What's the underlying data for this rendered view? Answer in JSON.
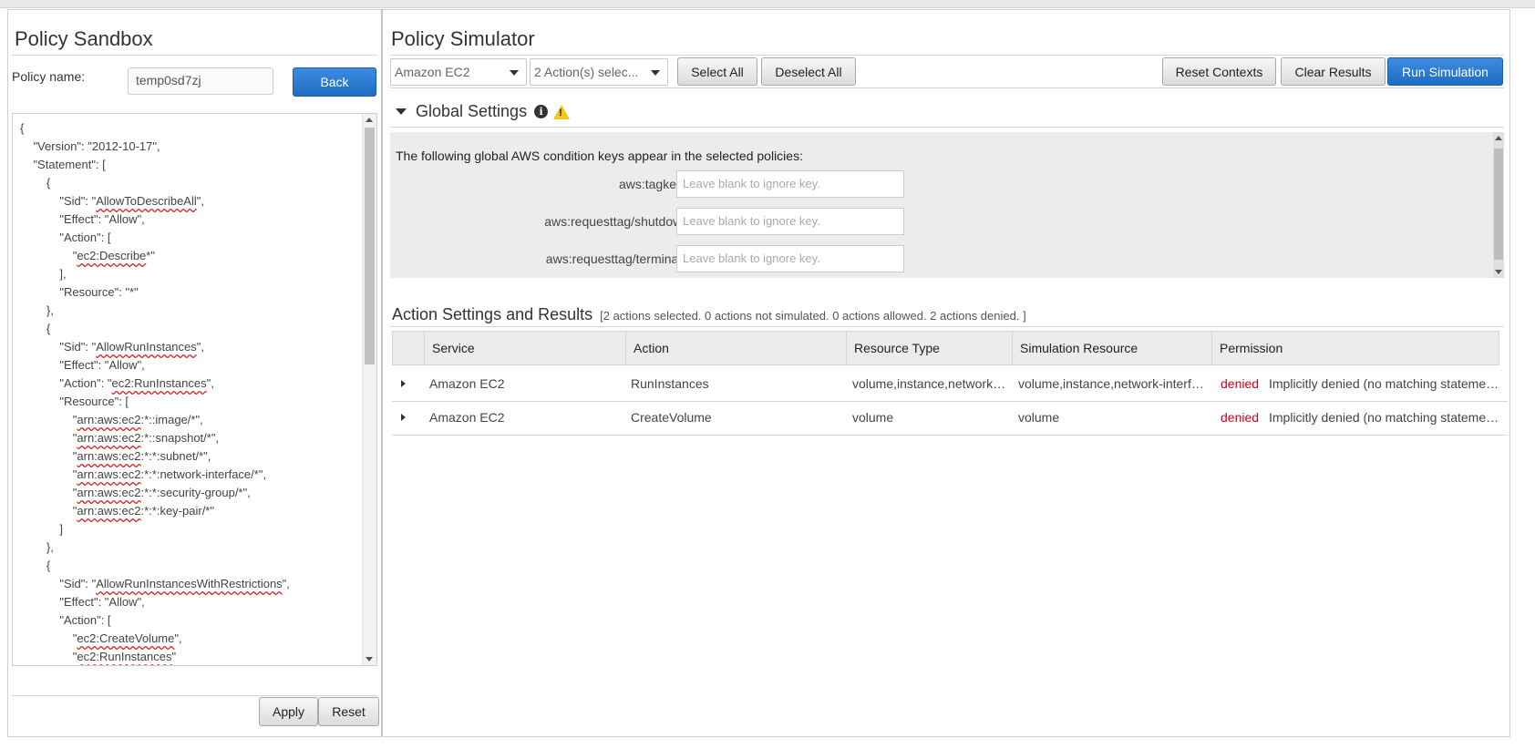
{
  "sandbox": {
    "title": "Policy Sandbox",
    "policy_name_label": "Policy name:",
    "policy_name_value": "temp0sd7zj",
    "back_label": "Back",
    "apply_label": "Apply",
    "reset_label": "Reset"
  },
  "editor_lines": [
    {
      "pre": "{",
      "sq": "",
      "post": ""
    },
    {
      "pre": "    \"Version\": \"2012-10-17\",",
      "sq": "",
      "post": ""
    },
    {
      "pre": "    \"Statement\": [",
      "sq": "",
      "post": ""
    },
    {
      "pre": "        {",
      "sq": "",
      "post": ""
    },
    {
      "pre": "            \"Sid\": \"",
      "sq": "AllowToDescribeAll",
      "post": "\","
    },
    {
      "pre": "            \"Effect\": \"Allow\",",
      "sq": "",
      "post": ""
    },
    {
      "pre": "            \"Action\": [",
      "sq": "",
      "post": ""
    },
    {
      "pre": "                \"",
      "sq": "ec2:Describe",
      "post": "*\""
    },
    {
      "pre": "            ],",
      "sq": "",
      "post": ""
    },
    {
      "pre": "            \"Resource\": \"*\"",
      "sq": "",
      "post": ""
    },
    {
      "pre": "        },",
      "sq": "",
      "post": ""
    },
    {
      "pre": "        {",
      "sq": "",
      "post": ""
    },
    {
      "pre": "            \"Sid\": \"",
      "sq": "AllowRunInstances",
      "post": "\","
    },
    {
      "pre": "            \"Effect\": \"Allow\",",
      "sq": "",
      "post": ""
    },
    {
      "pre": "            \"Action\": \"",
      "sq": "ec2:RunInstances",
      "post": "\","
    },
    {
      "pre": "            \"Resource\": [",
      "sq": "",
      "post": ""
    },
    {
      "pre": "                \"",
      "sq": "arn:aws:ec2",
      "post": ":*::image/*\","
    },
    {
      "pre": "                \"",
      "sq": "arn:aws:ec2",
      "post": ":*::snapshot/*\","
    },
    {
      "pre": "                \"",
      "sq": "arn:aws:ec2",
      "post": ":*:*:subnet/*\","
    },
    {
      "pre": "                \"",
      "sq": "arn:aws:ec2",
      "post": ":*:*:network-interface/*\","
    },
    {
      "pre": "                \"",
      "sq": "arn:aws:ec2",
      "post": ":*:*:security-group/*\","
    },
    {
      "pre": "                \"",
      "sq": "arn:aws:ec2",
      "post": ":*:*:key-pair/*\""
    },
    {
      "pre": "            ]",
      "sq": "",
      "post": ""
    },
    {
      "pre": "        },",
      "sq": "",
      "post": ""
    },
    {
      "pre": "        {",
      "sq": "",
      "post": ""
    },
    {
      "pre": "            \"Sid\": \"",
      "sq": "AllowRunInstancesWithRestrictions",
      "post": "\","
    },
    {
      "pre": "            \"Effect\": \"Allow\",",
      "sq": "",
      "post": ""
    },
    {
      "pre": "            \"Action\": [",
      "sq": "",
      "post": ""
    },
    {
      "pre": "                \"",
      "sq": "ec2:CreateVolume",
      "post": "\","
    },
    {
      "pre": "                \"",
      "sq": "ec2:RunInstances",
      "post": "\""
    }
  ],
  "simulator": {
    "title": "Policy Simulator",
    "service_select": "Amazon EC2",
    "actions_select": "2 Action(s) selec...",
    "select_all_label": "Select All",
    "deselect_all_label": "Deselect All",
    "reset_contexts_label": "Reset Contexts",
    "clear_results_label": "Clear Results",
    "run_simulation_label": "Run Simulation"
  },
  "global_settings": {
    "title": "Global Settings",
    "description": "The following global AWS condition keys appear in the selected policies:",
    "keys": [
      {
        "label": "aws:tagkeys",
        "placeholder": "Leave blank to ignore key."
      },
      {
        "label": "aws:requesttag/shutdown",
        "placeholder": "Leave blank to ignore key."
      },
      {
        "label": "aws:requesttag/terminate",
        "placeholder": "Leave blank to ignore key."
      }
    ]
  },
  "results": {
    "title": "Action Settings and Results",
    "summary": "[2 actions selected. 0 actions not simulated. 0 actions allowed. 2 actions denied. ]",
    "columns": [
      "Service",
      "Action",
      "Resource Type",
      "Simulation Resource",
      "Permission"
    ],
    "rows": [
      {
        "service": "Amazon EC2",
        "action": "RunInstances",
        "resource_type": "volume,instance,network-i...",
        "simulation_resource": "volume,instance,network-interfa...",
        "status": "denied",
        "detail": "Implicitly denied (no matching statemen..."
      },
      {
        "service": "Amazon EC2",
        "action": "CreateVolume",
        "resource_type": "volume",
        "simulation_resource": "volume",
        "status": "denied",
        "detail": "Implicitly denied (no matching statemen..."
      }
    ]
  },
  "colors": {
    "primary_button": "#1f6dc4",
    "denied": "#d0021b",
    "warning": "#f0c419"
  }
}
